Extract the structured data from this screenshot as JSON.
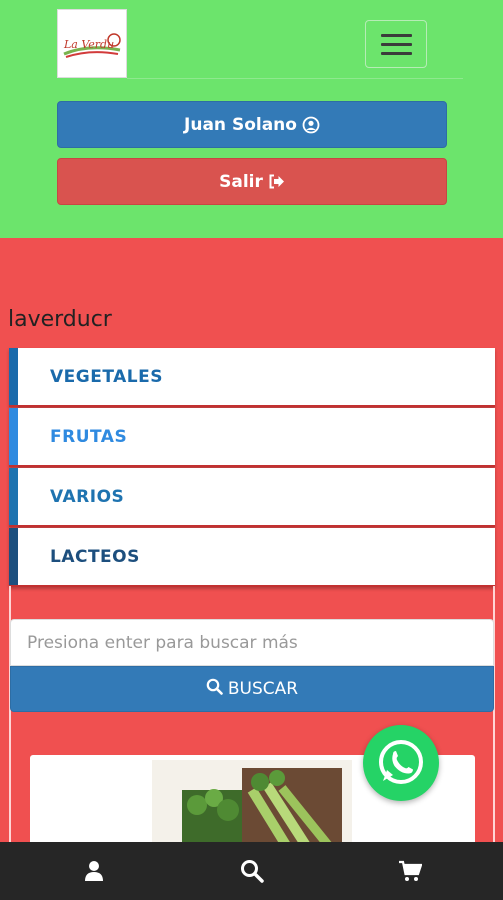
{
  "header": {
    "logo_text": "La Verdu",
    "menu_toggle": "menu-toggle"
  },
  "user": {
    "name": "Juan Solano",
    "icon": "user-circle-icon"
  },
  "exit": {
    "label": "Salir",
    "icon": "sign-out-icon"
  },
  "section_title": "laverducr",
  "categories": [
    {
      "label": "VEGETALES",
      "color": "#1a6aab",
      "text_color": "#1a6aab"
    },
    {
      "label": "FRUTAS",
      "color": "#2f8ae0",
      "text_color": "#2f8ae0"
    },
    {
      "label": "VARIOS",
      "color": "#1e73b0",
      "text_color": "#1e73b0"
    },
    {
      "label": "LACTEOS",
      "color": "#1d4f7e",
      "text_color": "#1d4f7e"
    }
  ],
  "search": {
    "placeholder": "Presiona enter para buscar más",
    "button_label": "BUSCAR",
    "button_icon": "search-icon"
  },
  "bottom_nav": {
    "items": [
      "user-icon",
      "search-icon",
      "cart-icon"
    ]
  },
  "colors": {
    "header_bg": "#6ce46c",
    "page_bg": "#f05050",
    "primary": "#337ab7",
    "danger": "#d9534f",
    "whatsapp": "#25d366"
  }
}
